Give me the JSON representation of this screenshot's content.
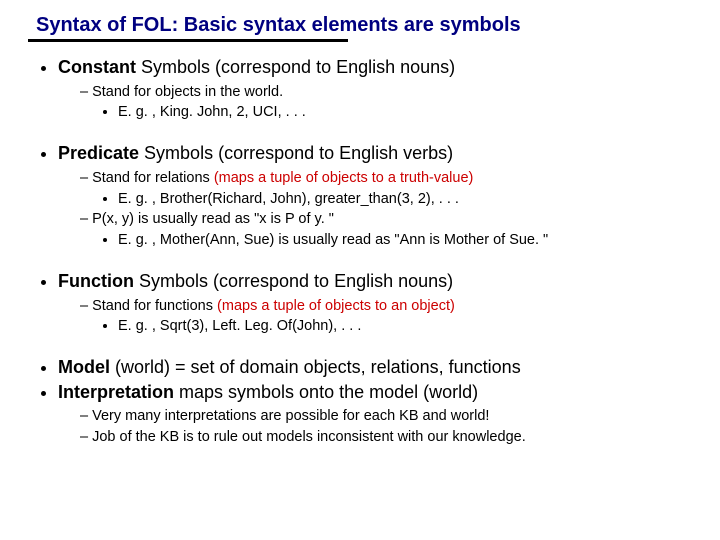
{
  "title": "Syntax of FOL: Basic syntax elements are symbols",
  "sec1": {
    "head_b": "Constant",
    "head_r": " Symbols (correspond to English nouns)",
    "p1": "Stand for objects in the world.",
    "p1e": "E. g. , King. John, 2, UCI, . . ."
  },
  "sec2": {
    "head_b": "Predicate",
    "head_r": " Symbols (correspond to English verbs)",
    "p1a": "Stand for relations ",
    "p1red": "(maps a tuple of objects to a truth-value)",
    "p1e": "E. g. , Brother(Richard, John), greater_than(3, 2), . . .",
    "p2": "P(x, y) is usually read as \"x is P of y. \"",
    "p2e": "E. g. , Mother(Ann, Sue) is usually read as \"Ann is Mother of Sue. \""
  },
  "sec3": {
    "head_b": "Function",
    "head_r": " Symbols (correspond to English nouns)",
    "p1a": "Stand for functions ",
    "p1red": "(maps a tuple of objects to an object)",
    "p1e": "E. g. , Sqrt(3), Left. Leg. Of(John), . . ."
  },
  "sec4": {
    "l1b": "Model",
    "l1r": " (world) = set of domain objects, relations, functions",
    "l2b": "Interpretation",
    "l2r": " maps symbols onto the model (world)",
    "p1": "Very many interpretations are possible for each KB and world!",
    "p2": "Job of the KB is to rule out models inconsistent with our knowledge."
  }
}
